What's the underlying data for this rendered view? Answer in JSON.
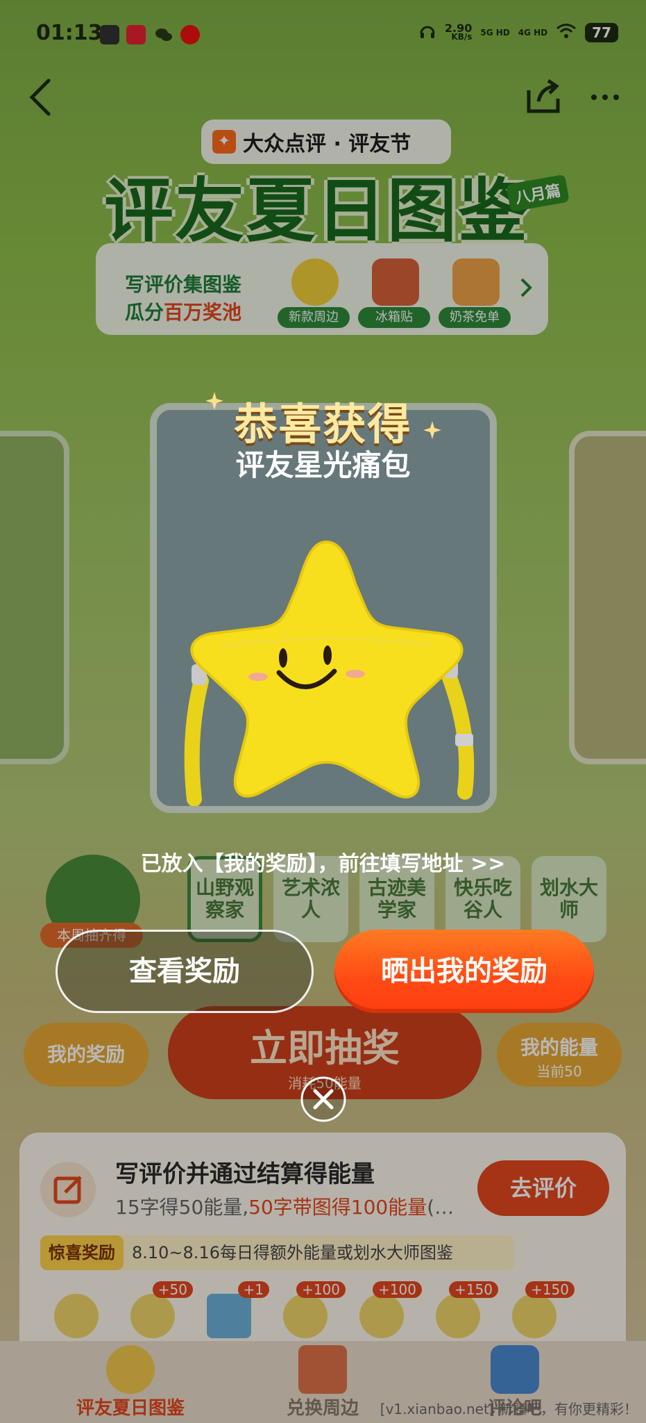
{
  "status_bar": {
    "time": "01:13",
    "speed": "2.90",
    "speed_unit": "KB/s",
    "net1": "5G HD",
    "net2": "4G HD",
    "battery": "77"
  },
  "header": {
    "brand": "大众点评 · 评友节",
    "title": "评友夏日图鉴",
    "month_tag": "八月篇"
  },
  "promo": {
    "line1": "写评价集图鉴",
    "line2_prefix": "瓜分",
    "line2_highlight": "百万奖池",
    "items": [
      {
        "label": "新款周边"
      },
      {
        "label": "冰箱贴"
      },
      {
        "label": "奶茶免单"
      }
    ]
  },
  "collection": {
    "badge": "本周抽齐得",
    "tiles": [
      {
        "label": "山野观察家"
      },
      {
        "label": "艺术浓人"
      },
      {
        "label": "古迹美学家"
      },
      {
        "label": "快乐吃谷人"
      },
      {
        "label": "划水大师"
      }
    ]
  },
  "actions": {
    "my_rewards": "我的奖励",
    "draw_title": "立即抽奖",
    "draw_sub": "消耗50能量",
    "my_energy": "我的能量",
    "energy_current": "当前50"
  },
  "task": {
    "title": "写评价并通过结算得能量",
    "desc_prefix": "15字得50能量,",
    "desc_highlight": "50字带图得100能量",
    "desc_suffix": "(…",
    "go_button": "去评价",
    "surprise_tag": "惊喜奖励",
    "surprise_text": "8.10~8.16每日得额外能量或划水大师图鉴",
    "badges": [
      "+50",
      "+1",
      "+100",
      "+100",
      "+150",
      "+150"
    ]
  },
  "tabbar": {
    "items": [
      {
        "label": "评友夏日图鉴",
        "color": "#e5471e"
      },
      {
        "label": "兑换周边",
        "color": "#8a7a6a"
      },
      {
        "label": "评论吧",
        "color": "#8a7a6a"
      }
    ]
  },
  "watermark": "[v1.xianbao.net] 新赚吧，有你更精彩！",
  "modal": {
    "title": "恭喜获得",
    "subtitle": "评友星光痛包",
    "notice": "已放入【我的奖励】，前往填写地址 >>",
    "secondary_button": "查看奖励",
    "primary_button": "晒出我的奖励",
    "accent_color": "#ff4a14",
    "prize_icon": "star-bag-icon"
  }
}
